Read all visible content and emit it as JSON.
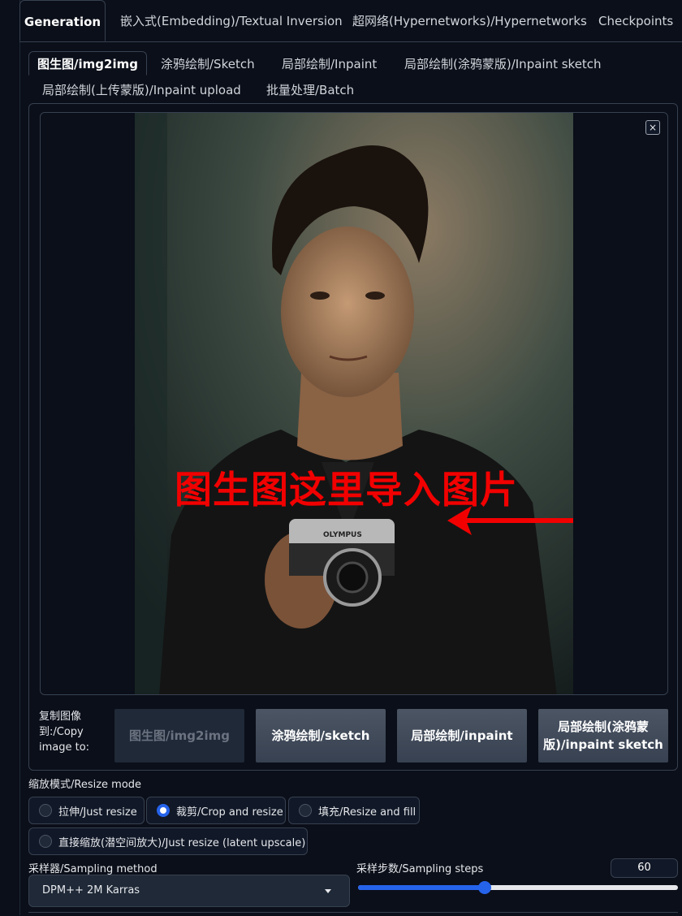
{
  "top_tabs": [
    {
      "label": "Generation",
      "active": true
    },
    {
      "label": "嵌入式(Embedding)/Textual Inversion",
      "active": false
    },
    {
      "label": "超网络(Hypernetworks)/Hypernetworks",
      "active": false
    },
    {
      "label": "Checkpoints",
      "active": false
    }
  ],
  "sub_tabs": [
    {
      "label": "图生图/img2img",
      "active": true
    },
    {
      "label": "涂鸦绘制/Sketch",
      "active": false
    },
    {
      "label": "局部绘制/Inpaint",
      "active": false
    },
    {
      "label": "局部绘制(涂鸦蒙版)/Inpaint sketch",
      "active": false
    },
    {
      "label": "局部绘制(上传蒙版)/Inpaint upload",
      "active": false
    },
    {
      "label": "批量处理/Batch",
      "active": false
    }
  ],
  "image_panel": {
    "close_symbol": "×",
    "overlay_text": "图生图这里导入图片",
    "camera_brand": "OLYMPUS",
    "arrow_color": "#f20000"
  },
  "copy_image": {
    "label": "复制图像到:/Copy image to:",
    "buttons": [
      {
        "label": "图生图/img2img",
        "enabled": false
      },
      {
        "label": "涂鸦绘制/sketch",
        "enabled": true
      },
      {
        "label": "局部绘制/inpaint",
        "enabled": true
      },
      {
        "label": "局部绘制(涂鸦蒙版)/inpaint sketch",
        "enabled": true
      }
    ]
  },
  "resize_mode": {
    "label": "缩放模式/Resize mode",
    "options": [
      {
        "label": "拉伸/Just resize",
        "selected": false
      },
      {
        "label": "裁剪/Crop and resize",
        "selected": true
      },
      {
        "label": "填充/Resize and fill",
        "selected": false
      },
      {
        "label": "直接缩放(潜空间放大)/Just resize (latent upscale)",
        "selected": false
      }
    ]
  },
  "sampling_method": {
    "label": "采样器/Sampling method",
    "value": "DPM++ 2M Karras"
  },
  "sampling_steps": {
    "label": "采样步数/Sampling steps",
    "value": "60",
    "min": 1,
    "max": 150
  },
  "colors": {
    "background": "#0b0f19",
    "accent": "#2563eb",
    "border": "#374151"
  }
}
